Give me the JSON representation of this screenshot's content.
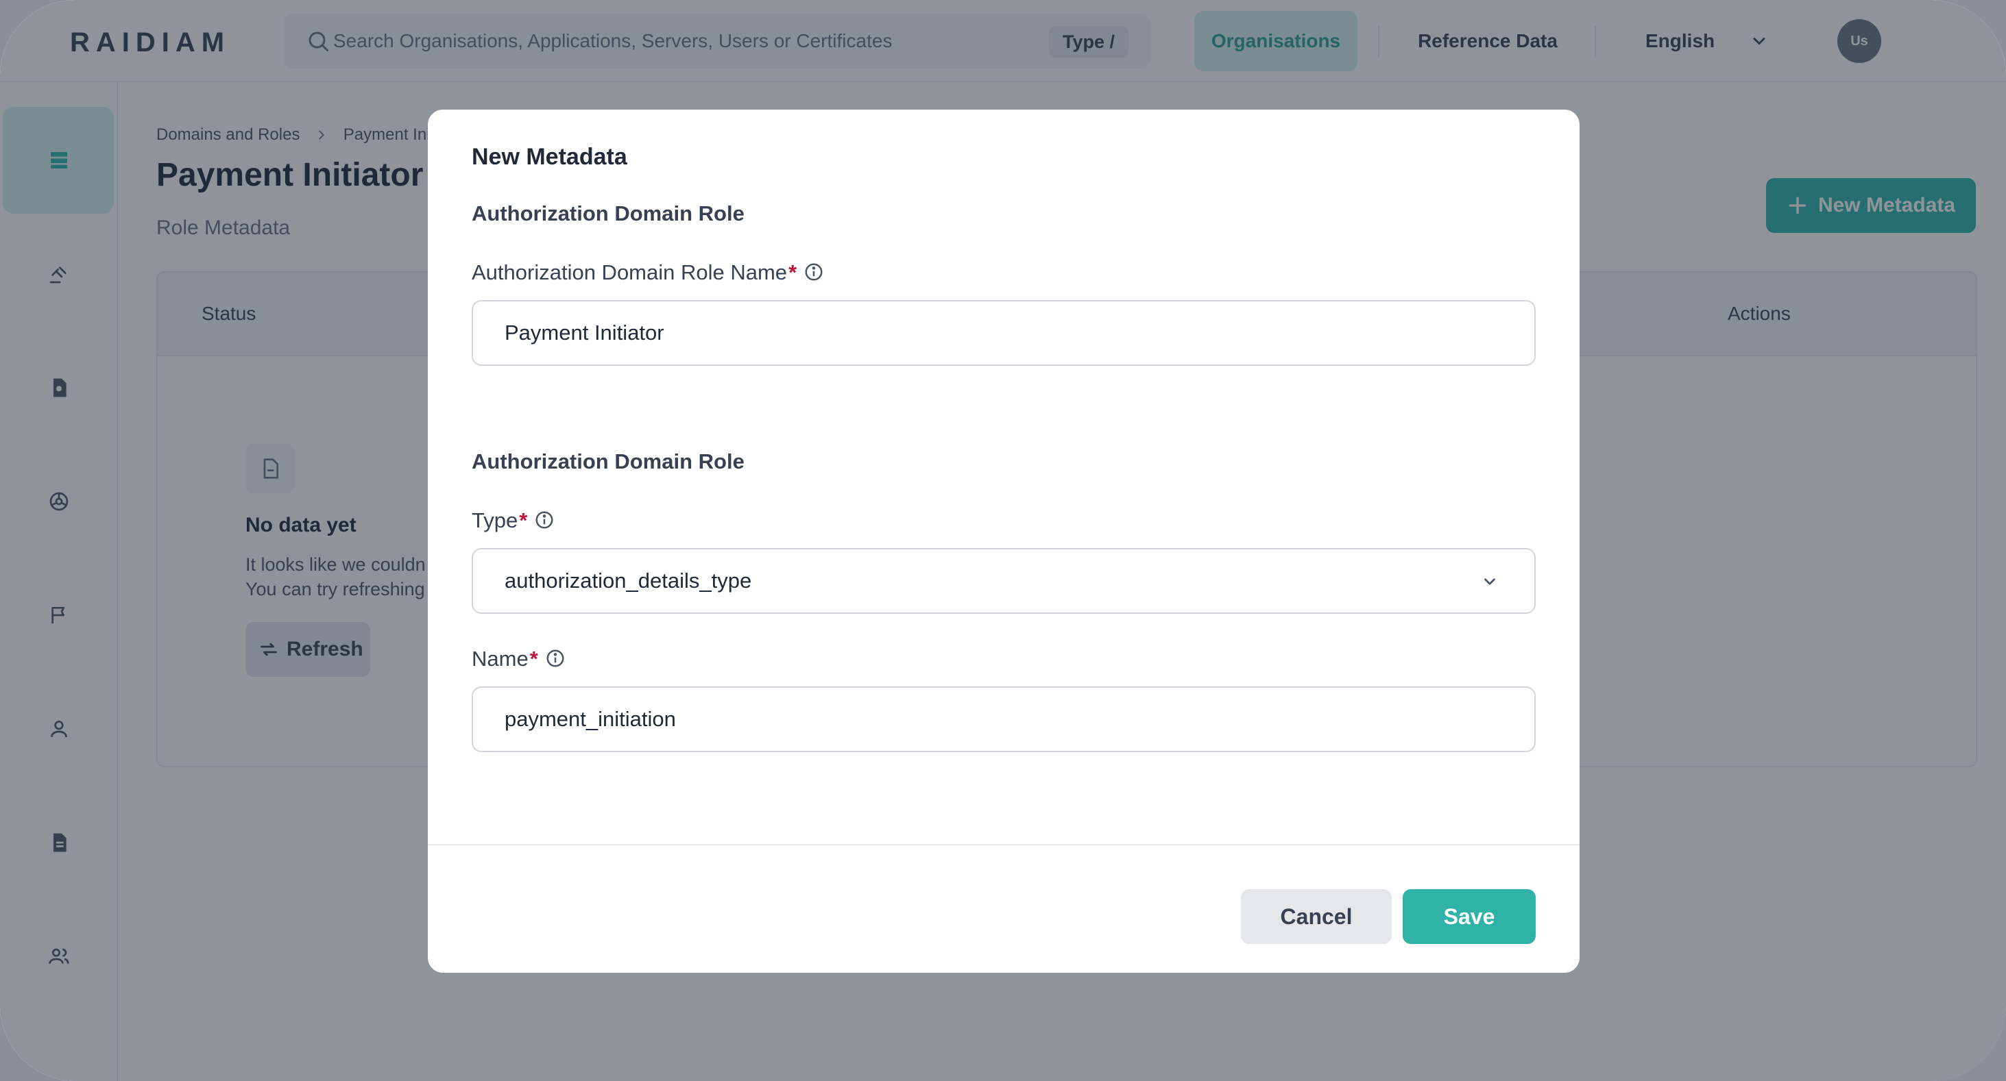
{
  "header": {
    "logo": "RAIDIAM",
    "search_placeholder": "Search Organisations, Applications, Servers, Users or Certificates",
    "search_shortcut": "Type /",
    "nav": {
      "organisations": "Organisations",
      "reference_data": "Reference Data",
      "language": "English"
    },
    "avatar_initials": "Us"
  },
  "sidebar": {
    "items": [
      {
        "icon": "server-icon",
        "active": true
      },
      {
        "icon": "gavel-icon"
      },
      {
        "icon": "certificate-icon"
      },
      {
        "icon": "globe-icon"
      },
      {
        "icon": "flag-icon"
      },
      {
        "icon": "user-icon"
      },
      {
        "icon": "document-icon"
      },
      {
        "icon": "users-icon"
      }
    ]
  },
  "page": {
    "breadcrumb": [
      "Domains and Roles",
      "Payment Initi"
    ],
    "title": "Payment Initiator",
    "subtitle": "Role Metadata",
    "new_button": "New Metadata",
    "table": {
      "columns": {
        "status": "Status",
        "actions": "Actions"
      },
      "empty": {
        "title": "No data yet",
        "line1": "It looks like we couldn",
        "line2": "You can try refreshing",
        "refresh": "Refresh"
      }
    }
  },
  "modal": {
    "title": "New Metadata",
    "section1": {
      "title": "Authorization Domain Role",
      "role_name_label": "Authorization Domain Role Name",
      "role_name_value": "Payment Initiator"
    },
    "section2": {
      "title": "Authorization Domain Role",
      "type_label": "Type",
      "type_value": "authorization_details_type",
      "name_label": "Name",
      "name_value": "payment_initiation"
    },
    "required_mark": "*",
    "cancel": "Cancel",
    "save": "Save"
  },
  "colors": {
    "accent": "#2fb2a8",
    "accent_light": "#d4f1ee",
    "required": "#be123c"
  }
}
